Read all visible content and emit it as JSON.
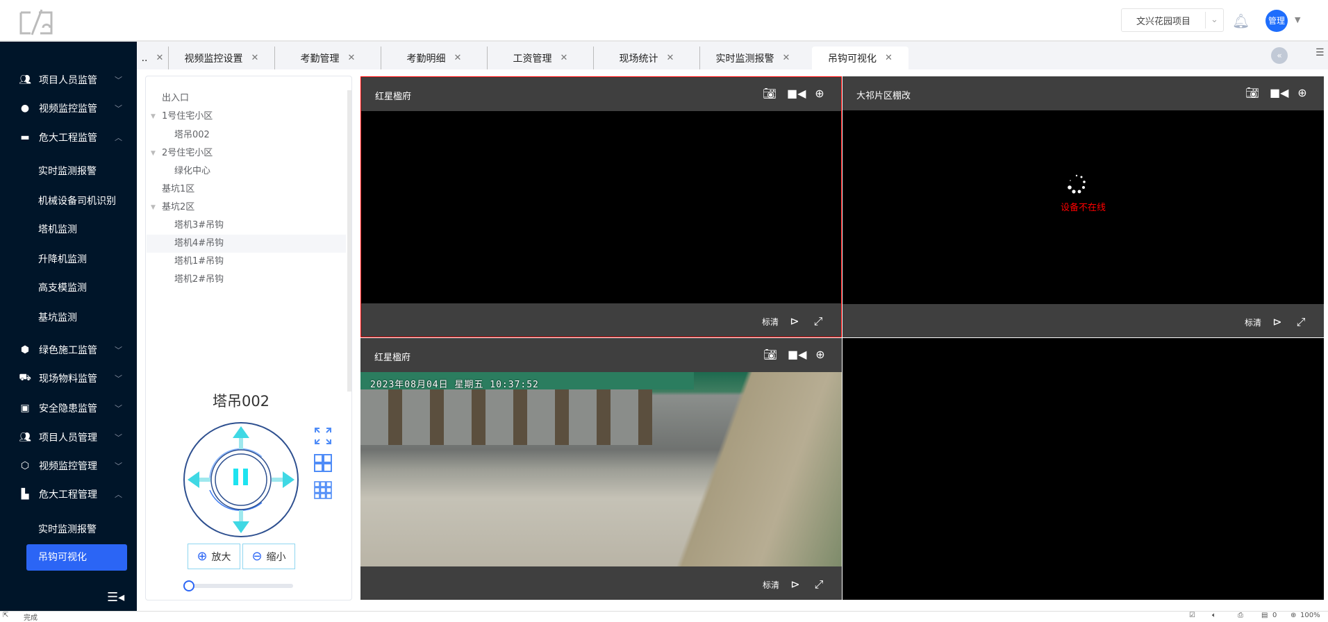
{
  "header": {
    "project_select": "文兴花园项目",
    "avatar_text": "管理"
  },
  "sidebar": {
    "groups": [
      {
        "label": "项目人员监管",
        "icon": "users-icon",
        "expanded": false
      },
      {
        "label": "视频监控监管",
        "icon": "camera-icon",
        "expanded": false
      },
      {
        "label": "危大工程监管",
        "icon": "toolbox-icon",
        "expanded": true,
        "children": [
          "实时监测报警",
          "机械设备司机识别",
          "塔机监测",
          "升降机监测",
          "高支模监测",
          "基坑监测"
        ]
      },
      {
        "label": "绿色施工监管",
        "icon": "shield-icon",
        "expanded": false
      },
      {
        "label": "现场物料监管",
        "icon": "truck-icon",
        "expanded": false
      },
      {
        "label": "安全隐患监管",
        "icon": "badge-icon",
        "expanded": false
      },
      {
        "label": "项目人员管理",
        "icon": "users-icon",
        "expanded": false
      },
      {
        "label": "视频监控管理",
        "icon": "cube-icon",
        "expanded": false
      },
      {
        "label": "危大工程管理",
        "icon": "building-icon",
        "expanded": true,
        "children": [
          "实时监测报警",
          "吊钩可视化"
        ]
      }
    ],
    "active": "吊钩可视化"
  },
  "tabs": [
    {
      "label": ".."
    },
    {
      "label": "视频监控设置"
    },
    {
      "label": "考勤管理"
    },
    {
      "label": "考勤明细"
    },
    {
      "label": "工资管理"
    },
    {
      "label": "现场统计"
    },
    {
      "label": "实时监测报警"
    },
    {
      "label": "吊钩可视化",
      "active": true
    }
  ],
  "tree": [
    {
      "label": "出入口",
      "level": 0
    },
    {
      "label": "1号住宅小区",
      "level": 0,
      "expandable": true
    },
    {
      "label": "塔吊002",
      "level": 1
    },
    {
      "label": "2号住宅小区",
      "level": 0,
      "expandable": true
    },
    {
      "label": "绿化中心",
      "level": 1
    },
    {
      "label": "基坑1区",
      "level": 0
    },
    {
      "label": "基坑2区",
      "level": 0,
      "expandable": true
    },
    {
      "label": "塔机3#吊钩",
      "level": 1
    },
    {
      "label": "塔机4#吊钩",
      "level": 1,
      "highlighted": true
    },
    {
      "label": "塔机1#吊钩",
      "level": 1
    },
    {
      "label": "塔机2#吊钩",
      "level": 1
    }
  ],
  "control": {
    "title": "塔吊002",
    "zoom_in": "放大",
    "zoom_out": "缩小",
    "slider_value": 0
  },
  "videos": [
    {
      "title": "红星楹府",
      "quality": "标清",
      "state": "black",
      "selected": true
    },
    {
      "title": "大祁片区棚改",
      "quality": "标清",
      "state": "offline",
      "message": "设备不在线"
    },
    {
      "title": "红星楹府",
      "quality": "标清",
      "state": "live",
      "timestamp": "2023年08月04日 星期五 10:37:52"
    },
    {
      "state": "empty"
    }
  ],
  "statusbar": {
    "text": "完成",
    "count": "0",
    "zoom": "100%"
  },
  "colors": {
    "sidebar": "#001529",
    "accent": "#2b65f5",
    "selected_border": "#ff0000",
    "offline": "#ff0000"
  }
}
